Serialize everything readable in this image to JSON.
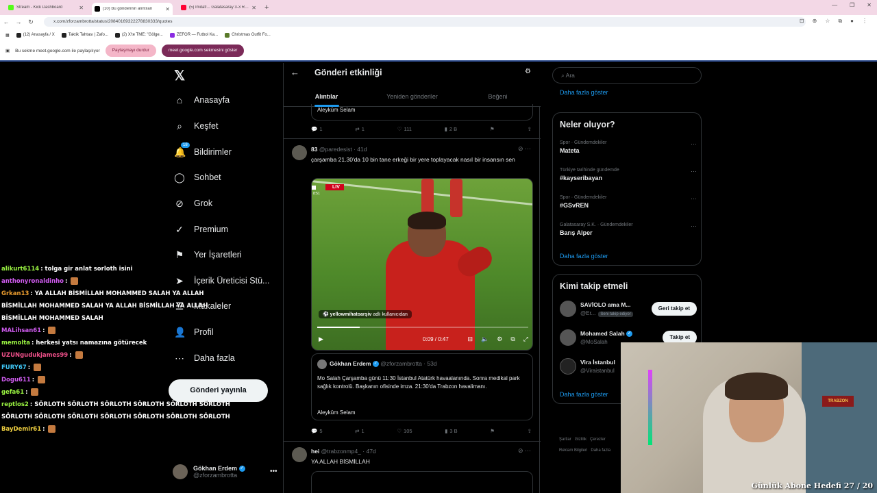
{
  "browser": {
    "tabs": [
      {
        "title": "Stream - Kick Dashboard",
        "color": "#53fc18"
      },
      {
        "title": "(10) Bu gönderinin alıntıları",
        "color": "#000000"
      },
      {
        "title": "(5) İmdat!... Galatasaray 3-3 Ren...",
        "color": "#ff0033"
      }
    ],
    "new_tab": "+",
    "url": "x.com/zforzambrotta/status/20840169322278830333/quotes",
    "bookmarks": [
      "(12) Anasayfa / X",
      "Taktik Tahtası | Zafo...",
      "(2) X'te TME: \"Gölge...",
      "ZEFOR — Futbol Ka...",
      "Christmas Outfit Fo..."
    ],
    "share_text": "Bu sekme meet.google.com ile paylaşılıyor",
    "stop_share": "Paylaşmayı durdur",
    "show_tab": "meet.google.com sekmesini göster"
  },
  "leftnav": {
    "items": [
      {
        "label": "Anasayfa",
        "icon": "⌂"
      },
      {
        "label": "Keşfet",
        "icon": "⌕"
      },
      {
        "label": "Bildirimler",
        "icon": "🔔",
        "badge": "18"
      },
      {
        "label": "Sohbet",
        "icon": "◯"
      },
      {
        "label": "Grok",
        "icon": "⊘"
      },
      {
        "label": "Premium",
        "icon": "✓"
      },
      {
        "label": "Yer İşaretleri",
        "icon": "⚑"
      },
      {
        "label": "İçerik Üreticisi Stü...",
        "icon": "➤"
      },
      {
        "label": "Makaleler",
        "icon": "☰"
      },
      {
        "label": "Profil",
        "icon": "👤"
      },
      {
        "label": "Daha fazla",
        "icon": "⋯"
      }
    ],
    "post_button": "Gönderi yayınla",
    "account": {
      "name": "Gökhan Erdem",
      "handle": "@zforzambrotta"
    }
  },
  "center": {
    "title": "Gönderi etkinliği",
    "tabs": [
      "Alıntılar",
      "Yeniden gönderiler",
      "Beğeni"
    ],
    "prev_tweet_tail": "Aleyküm Selam",
    "prev_actions": {
      "reply": "1",
      "repost": "1",
      "like": "111",
      "views": "2 B"
    },
    "tweet2": {
      "name": "83",
      "handle": "@paredesist",
      "time": "41d",
      "text": "çarşamba 21.30'da 10 bin tane erkeği bir yere toplayacak nasıl bir insansın sen",
      "video": {
        "live": "LIV",
        "clock": "8:51",
        "attribution_user": "yellowmihatoarşiv",
        "attribution_suffix": "adlı kullanıcıdan",
        "time": "0:09 / 0:47",
        "progress": 0.2
      },
      "quote": {
        "name": "Gökhan Erdem",
        "handle": "@zforzambrotta",
        "time": "53d",
        "text": "Mo Salah Çarşamba günü 11:30 İstanbul Atatürk havaalanında. Sonra medikal park sağlık kontrolü. Başkanın ofisinde imza. 21:30'da Trabzon havalimanı.",
        "sign": "Aleyküm Selam"
      },
      "actions": {
        "reply": "5",
        "repost": "1",
        "like": "105",
        "views": "3 B"
      }
    },
    "tweet3": {
      "name": "hei",
      "handle": "@trabzonmp4_",
      "time": "47d",
      "text": "YA ALLAH BİSMİLLAH"
    }
  },
  "right": {
    "search_placeholder": "Ara",
    "show_more": "Daha fazla göster",
    "trends_title": "Neler oluyor?",
    "trends": [
      {
        "category": "Spor · Gündemdekiler",
        "name": "Mateta"
      },
      {
        "category": "Türkiye tarihinde gündemde",
        "name": "#kayseribayan"
      },
      {
        "category": "Spor · Gündemdekiler",
        "name": "#GSvREN"
      },
      {
        "category": "Galatasaray S.K. · Gündemdekiler",
        "name": "Barış Alper"
      }
    ],
    "who_title": "Kimi takip etmeli",
    "who": [
      {
        "name": "SAVİOLO ama M...",
        "handle": "@Er...",
        "tag": "Seni takip ediyor",
        "button": "Geri takip et"
      },
      {
        "name": "Mohamed Salah",
        "handle": "@MoSalah",
        "tag": "",
        "button": "Takip et"
      },
      {
        "name": "Vira İstanbul",
        "handle": "@Viraistanbul",
        "tag": "",
        "button": ""
      }
    ],
    "footer": [
      "Şartlar",
      "Gizlilik",
      "Çerezler",
      "Reklam Bilgileri",
      "Daha fazla"
    ]
  },
  "chat": [
    {
      "user": "alikurt6114",
      "color": "#9bf542",
      "msg": "tolga gir anlat sorloth isini"
    },
    {
      "user": "anthonyronaldinho",
      "color": "#d05cf0",
      "msg": ""
    },
    {
      "user": "Grkan13",
      "color": "#f0a030",
      "msg": "YA ALLAH BİSMİLLAH MOHAMMED SALAH YA ALLAH BİSMİLLAH MOHAMMED SALAH YA ALLAH BİSMİLLAH YA ALLAH BİSMİLLAH MOHAMMED SALAH"
    },
    {
      "user": "MALihsan61",
      "color": "#d05cf0",
      "msg": ""
    },
    {
      "user": "memolta",
      "color": "#9bf542",
      "msg": "herkesi yatsı namazına götürecek"
    },
    {
      "user": "UZUNgudukjames99",
      "color": "#f0508a",
      "msg": ""
    },
    {
      "user": "FURY67",
      "color": "#3fc6f5",
      "msg": ""
    },
    {
      "user": "Dogu611",
      "color": "#d05cf0",
      "msg": ""
    },
    {
      "user": "gefa61",
      "color": "#9bf542",
      "msg": ""
    },
    {
      "user": "reptlos2",
      "color": "#9bf542",
      "msg": "SÖRLOTH SÖRLOTH SÖRLOTH SÖRLOTH SÖRLOTH SÖRLOTH SÖRLOTH SÖRLOTH SÖRLOTH SÖRLOTH SÖRLOTH SÖRLOTH SÖRLOTH"
    },
    {
      "user": "BayDemir61",
      "color": "#f0d040",
      "msg": ""
    }
  ],
  "webcam": {
    "goal_text": "Günlük Abone Hedefi 27 / 20",
    "shelf_label": "TRABZON"
  }
}
